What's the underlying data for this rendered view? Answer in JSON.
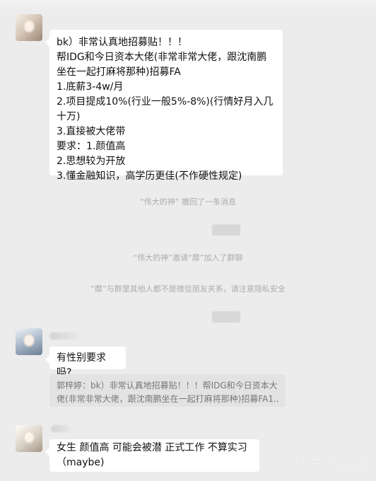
{
  "messages": [
    {
      "lines": [
        "bk）非常认真地招募贴！！！",
        "帮IDG和今日资本大佬(非常非常大佬，跟沈南鹏坐在一起打麻将那种)招募FA",
        "1.底薪3-4w/月",
        "2.项目提成10%(行业一般5%-8%)(行情好月入几十万)",
        "3.直接被大佬带",
        "要求：1.颜值高",
        "2.思想较为开放",
        "3.懂金融知识，高学历更佳(不作硬性规定)"
      ]
    },
    {
      "lines": [
        "有性别要求吗?"
      ]
    },
    {
      "lines": [
        "女生 颜值高 可能会被潜 正式工作 不算实习 （maybe)"
      ]
    }
  ],
  "system": {
    "recall": "“伟大的神” 撤回了一条消息",
    "invite": "“伟大的神”邀请“靡”加入了群聊",
    "warning": "“靡”与群里其他人都不是微信朋友关系，请注意隐私安全"
  },
  "quote": {
    "lines": [
      "郭梓婷：bk）非常认真地招募贴！！！帮IDG和今日资本大",
      "佬(非常非常大佬，跟沈南鹏坐在一起打麻将那种)招募FA1..."
    ]
  },
  "watermark": "知乎 @殷浩天"
}
